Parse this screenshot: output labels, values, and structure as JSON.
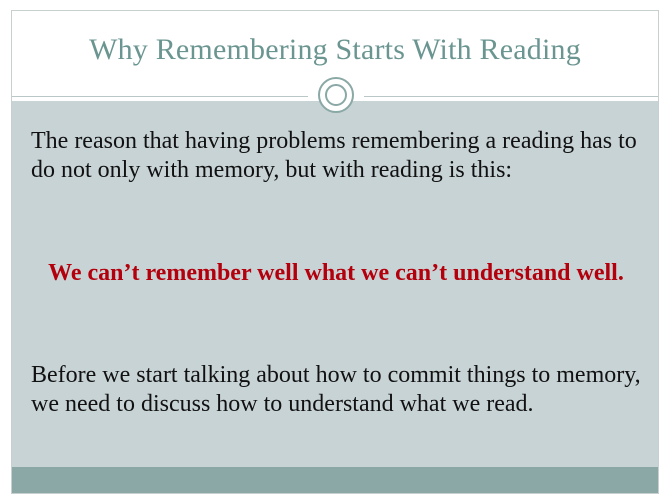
{
  "slide": {
    "title": "Why Remembering Starts With Reading",
    "paragraph1": "The reason that having problems remembering a reading has to do not only with memory, but with reading is this:",
    "emphasis": "We can’t remember well what we can’t understand well.",
    "paragraph2": "Before we start talking about how to commit things to memory, we need to discuss how to understand what we read."
  },
  "colors": {
    "title": "#6a9591",
    "content_background": "#c8d3d6",
    "emphasis": "#b3000c",
    "footer_bar": "#8ba8a6"
  }
}
